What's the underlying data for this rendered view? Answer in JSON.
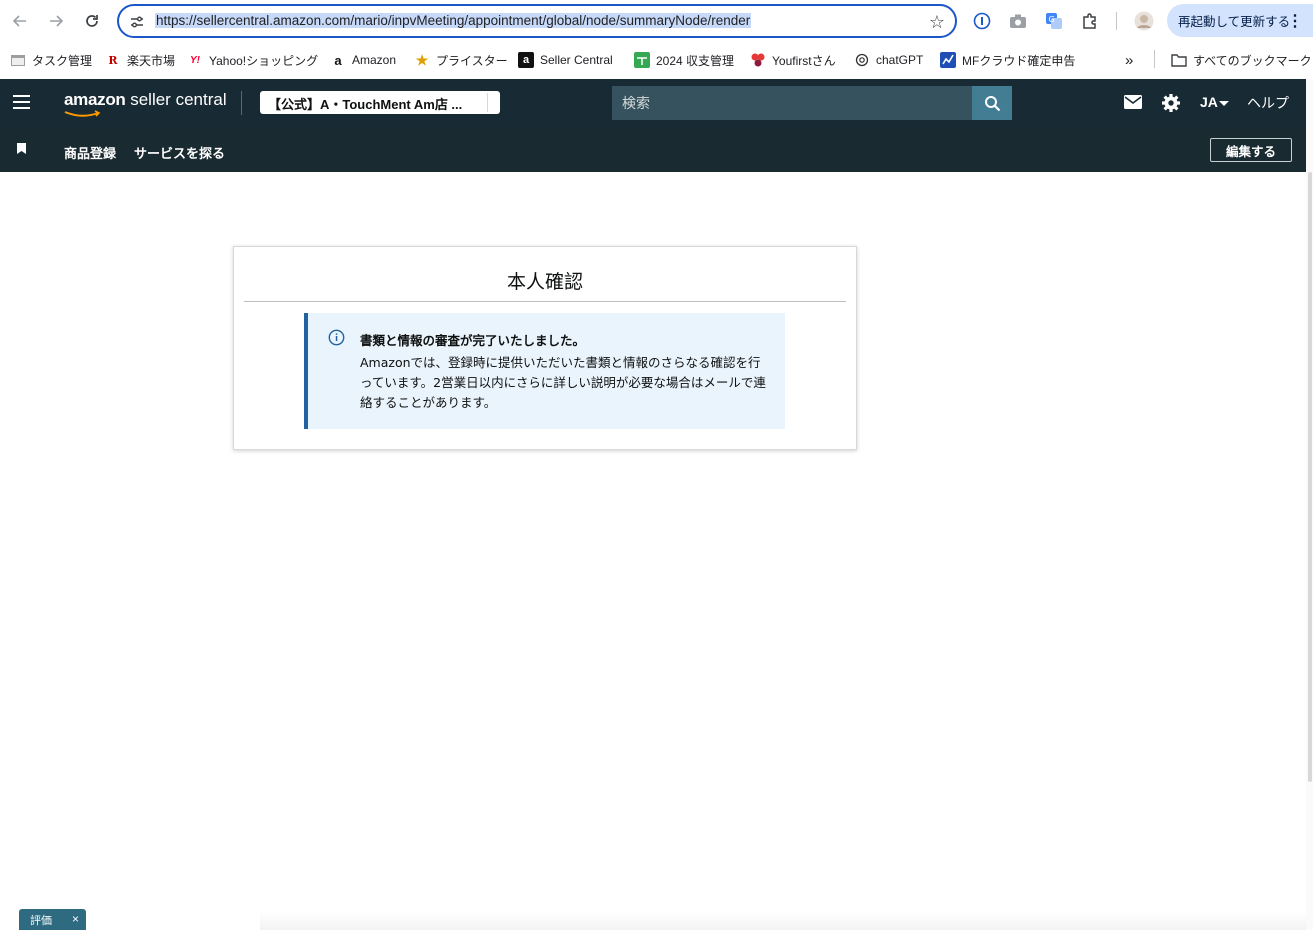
{
  "browser": {
    "url": "https://sellercentral.amazon.com/mario/inpvMeeting/appointment/global/node/summaryNode/render",
    "restart_label": "再起動して更新する"
  },
  "bookmarks": [
    {
      "label": "タスク管理",
      "icon": "calendar-icon"
    },
    {
      "label": "楽天市場",
      "icon": "rakuten-icon"
    },
    {
      "label": "Yahoo!ショッピング",
      "icon": "yahoo-icon"
    },
    {
      "label": "Amazon",
      "icon": "amazon-icon"
    },
    {
      "label": "プライスター",
      "icon": "star-icon"
    },
    {
      "label": "Seller Central",
      "icon": "amazon-a-icon"
    },
    {
      "label": "2024 収支管理",
      "icon": "sheets-icon"
    },
    {
      "label": "Youfirstさん",
      "icon": "flower-icon"
    },
    {
      "label": "chatGPT",
      "icon": "openai-icon"
    },
    {
      "label": "MFクラウド確定申告",
      "icon": "mf-icon"
    }
  ],
  "bookmarks_all_label": "すべてのブックマーク",
  "header": {
    "logo_text_bold": "amazon",
    "logo_text": " seller central",
    "store_name": "【公式】A・TouchMent Am店 ...",
    "search_placeholder": "検索",
    "language": "JA",
    "help_label": "ヘルプ"
  },
  "subnav": {
    "items": [
      "商品登録",
      "サービスを探る"
    ],
    "edit_label": "編集する"
  },
  "card": {
    "title": "本人確認",
    "alert_heading": "書類と情報の審査が完了いたしました。",
    "alert_body": "Amazonでは、登録時に提供いただいた書類と情報のさらなる確認を行っています。2営業日以内にさらに詳しい説明が必要な場合はメールで連絡することがあります。"
  },
  "feedback": {
    "label": "評価",
    "close": "×"
  },
  "colors": {
    "header_bg": "#182a33",
    "alert_bg": "#eaf4fc",
    "alert_border": "#2162a1",
    "url_focus": "#1a57c8"
  }
}
